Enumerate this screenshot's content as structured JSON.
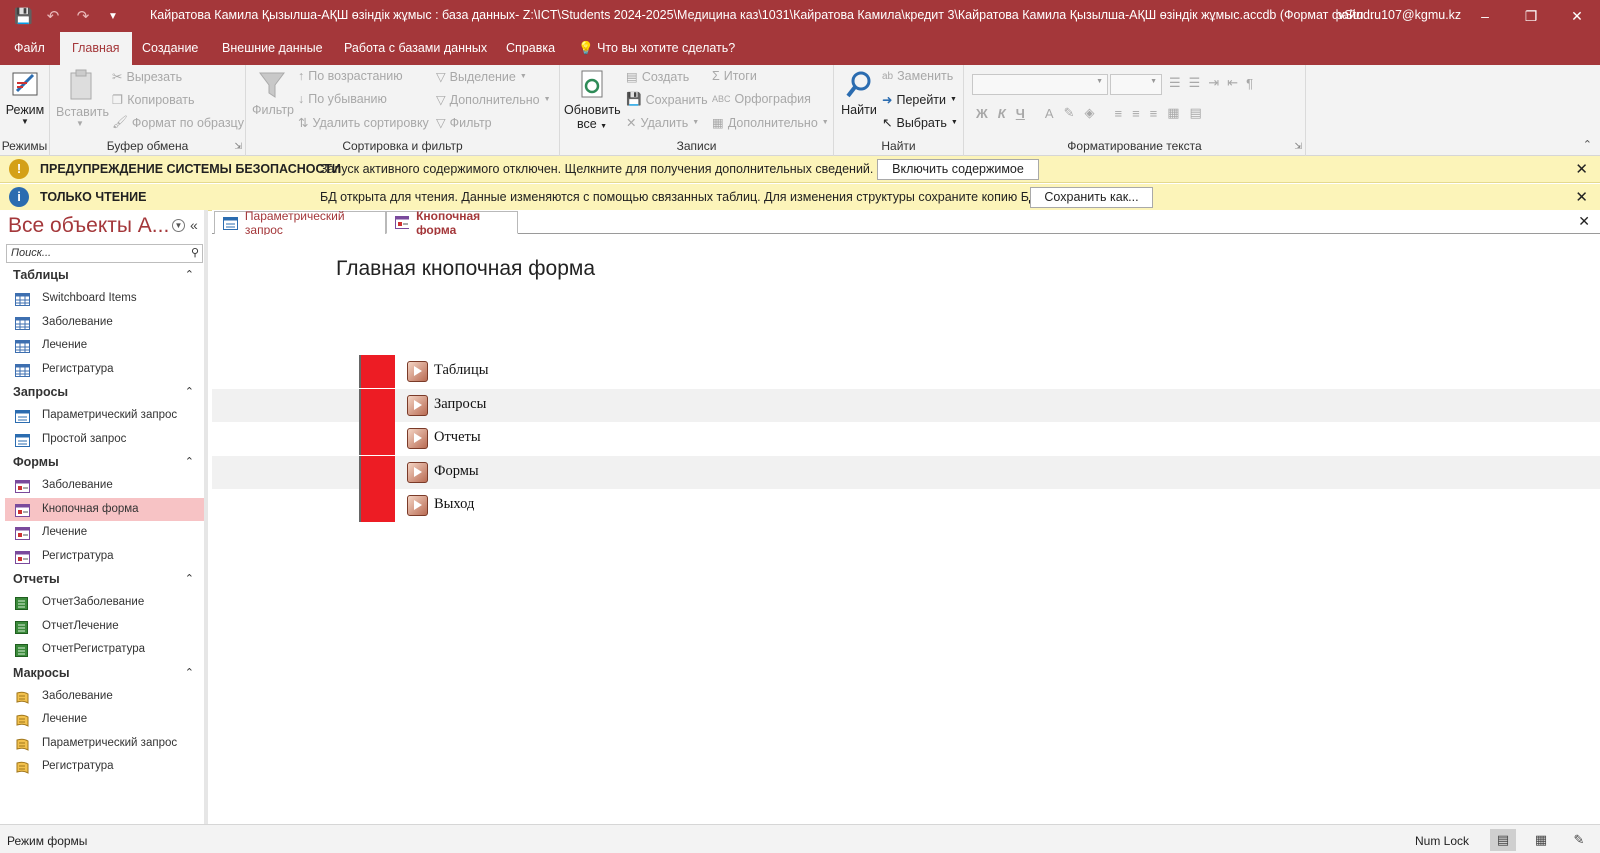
{
  "titlebar": {
    "title": "Кайратова Камила Қызылша-АҚШ өзіндік жұмыс : база данных- Z:\\ICT\\Students 2024-2025\\Медицина каз\\1031\\Кайратова Камила\\кредит 3\\Кайратова Камила Қызылша-АҚШ өзіндік жұмыс.accdb (Формат файл...",
    "user": "vStudru107@kgmu.kz"
  },
  "ribbon_tabs": [
    "Файл",
    "Главная",
    "Создание",
    "Внешние данные",
    "Работа с базами данных",
    "Справка"
  ],
  "tellme": "Что вы хотите сделать?",
  "groups": {
    "views": {
      "label": "Режимы",
      "mode": "Режим"
    },
    "clipboard": {
      "label": "Буфер обмена",
      "paste": "Вставить",
      "cut": "Вырезать",
      "copy": "Копировать",
      "format_painter": "Формат по образцу"
    },
    "sort": {
      "label": "Сортировка и фильтр",
      "filter": "Фильтр",
      "ascending": "По возрастанию",
      "descending": "По убыванию",
      "remove_sort": "Удалить сортировку",
      "selection": "Выделение",
      "advanced": "Дополнительно",
      "toggle_filter": "Фильтр"
    },
    "records": {
      "label": "Записи",
      "refresh": "Обновить",
      "refresh2": "все",
      "new": "Создать",
      "save": "Сохранить",
      "delete": "Удалить",
      "totals": "Итоги",
      "spelling": "Орфография",
      "more": "Дополнительно"
    },
    "find": {
      "label": "Найти",
      "find": "Найти",
      "replace": "Заменить",
      "goto": "Перейти",
      "select": "Выбрать"
    },
    "text": {
      "label": "Форматирование текста",
      "bold": "Ж",
      "italic": "К",
      "underline": "Ч",
      "font_color": "A"
    }
  },
  "security_bar": {
    "title": "ПРЕДУПРЕЖДЕНИЕ СИСТЕМЫ БЕЗОПАСНОСТИ",
    "text": "Запуск активного содержимого отключен. Щелкните для получения дополнительных сведений.",
    "button": "Включить содержимое"
  },
  "readonly_bar": {
    "title": "ТОЛЬКО ЧТЕНИЕ",
    "text": "БД открыта для чтения. Данные изменяются с помощью связанных таблиц. Для изменения структуры сохраните копию БД.",
    "button": "Сохранить как..."
  },
  "nav": {
    "header": "Все объекты А...",
    "search_placeholder": "Поиск...",
    "groups": [
      {
        "name": "Таблицы",
        "icon": "table-icon",
        "items": [
          "Switchboard Items",
          "Заболевание",
          "Лечение",
          "Регистратура"
        ]
      },
      {
        "name": "Запросы",
        "icon": "query-icon",
        "items": [
          "Параметрический запрос",
          "Простой запрос"
        ]
      },
      {
        "name": "Формы",
        "icon": "form-icon",
        "items": [
          "Заболевание",
          "Кнопочная форма",
          "Лечение",
          "Регистратура"
        ]
      },
      {
        "name": "Отчеты",
        "icon": "report-icon",
        "items": [
          "ОтчетЗаболевание",
          "ОтчетЛечение",
          "ОтчетРегистратура"
        ]
      },
      {
        "name": "Макросы",
        "icon": "macro-icon",
        "items": [
          "Заболевание",
          "Лечение",
          "Параметрический запрос",
          "Регистратура"
        ]
      }
    ],
    "selected": "Кнопочная форма"
  },
  "doc_tabs": [
    {
      "label": "Параметрический запрос",
      "active": false
    },
    {
      "label": "Кнопочная форма",
      "active": true
    }
  ],
  "form": {
    "title": "Главная кнопочная форма",
    "buttons": [
      "Таблицы",
      "Запросы",
      "Отчеты",
      "Формы",
      "Выход"
    ]
  },
  "status": {
    "left": "Режим формы",
    "numlock": "Num Lock"
  },
  "colors": {
    "accent": "#a4373a",
    "switchboard_red": "#ed1c24",
    "message_bar": "#fcf4b9",
    "nav_selected": "#f7c3c5"
  }
}
